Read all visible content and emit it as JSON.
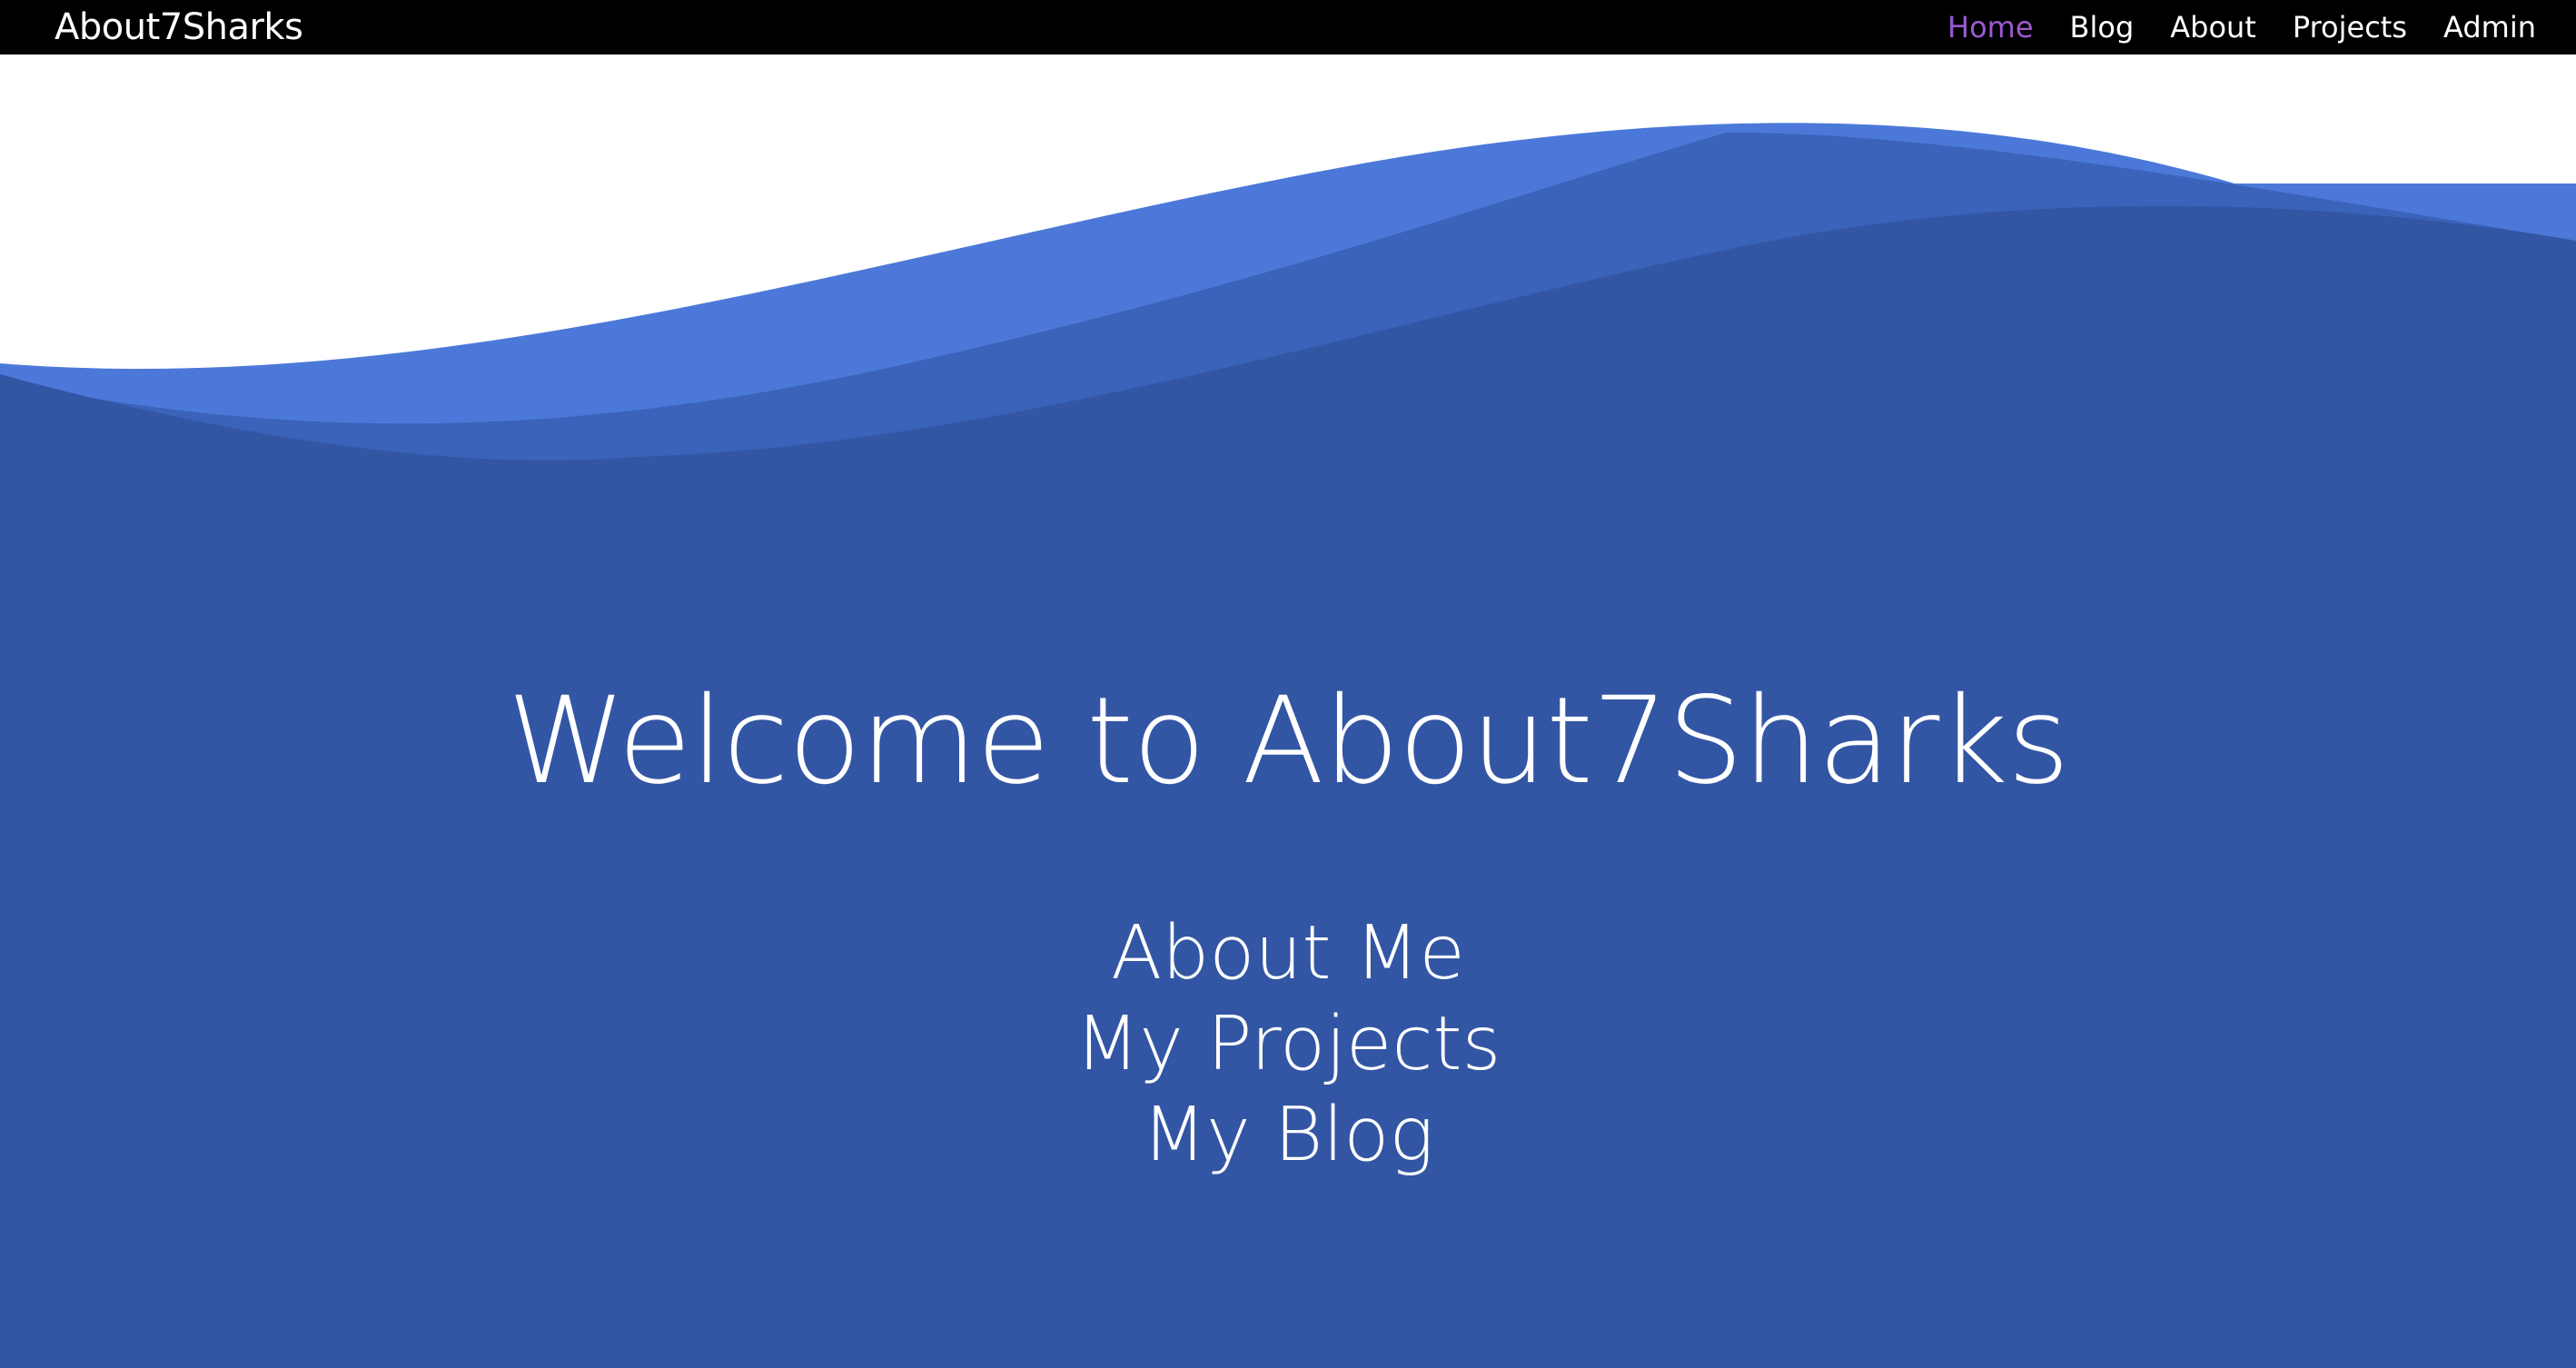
{
  "nav": {
    "brand": "About7Sharks",
    "items": [
      {
        "label": "Home",
        "active": true
      },
      {
        "label": "Blog",
        "active": false
      },
      {
        "label": "About",
        "active": false
      },
      {
        "label": "Projects",
        "active": false
      },
      {
        "label": "Admin",
        "active": false
      }
    ],
    "active_color": "#9b59d0"
  },
  "hero": {
    "title": "Welcome to About7Sharks",
    "links": [
      "About Me",
      "My Projects",
      "My Blog"
    ]
  },
  "colors": {
    "navbar": "#000000",
    "wave_light": "#4c79d9",
    "wave_mid": "#3a63b9",
    "background": "#3256a4",
    "text": "#ffffff"
  }
}
